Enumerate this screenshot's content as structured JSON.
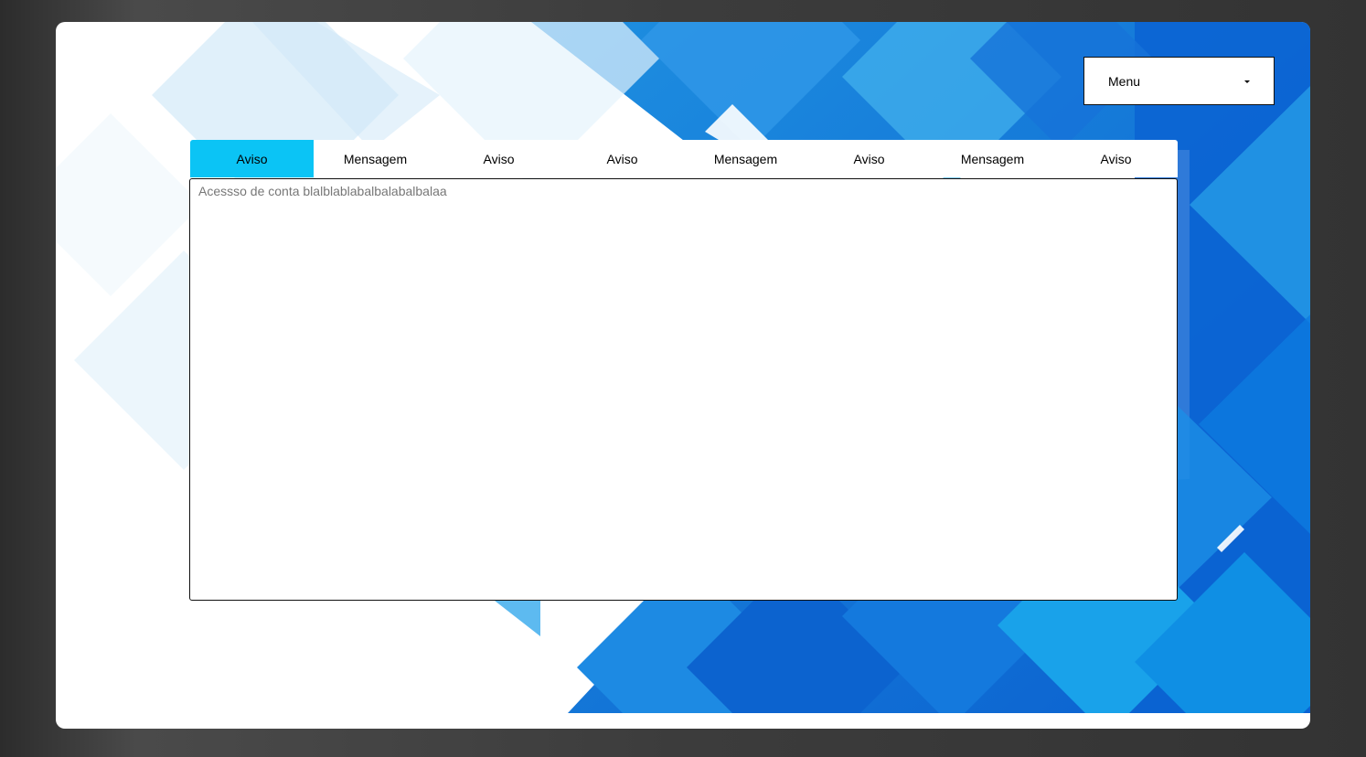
{
  "menu": {
    "label": "Menu",
    "caret_icon": "caret-down-icon"
  },
  "tabs": [
    {
      "label": "Aviso",
      "active": true
    },
    {
      "label": "Mensagem",
      "active": false
    },
    {
      "label": "Aviso",
      "active": false
    },
    {
      "label": "Aviso",
      "active": false
    },
    {
      "label": "Mensagem",
      "active": false
    },
    {
      "label": "Aviso",
      "active": false
    },
    {
      "label": "Mensagem",
      "active": false
    },
    {
      "label": "Aviso",
      "active": false
    }
  ],
  "content": {
    "text": "Acessso de conta blalblablabalbalabalbalaa"
  },
  "colors": {
    "active_tab": "#0bc4f5",
    "accent_blue": "#0a6fd6",
    "backdrop": "#3a3a3a"
  }
}
